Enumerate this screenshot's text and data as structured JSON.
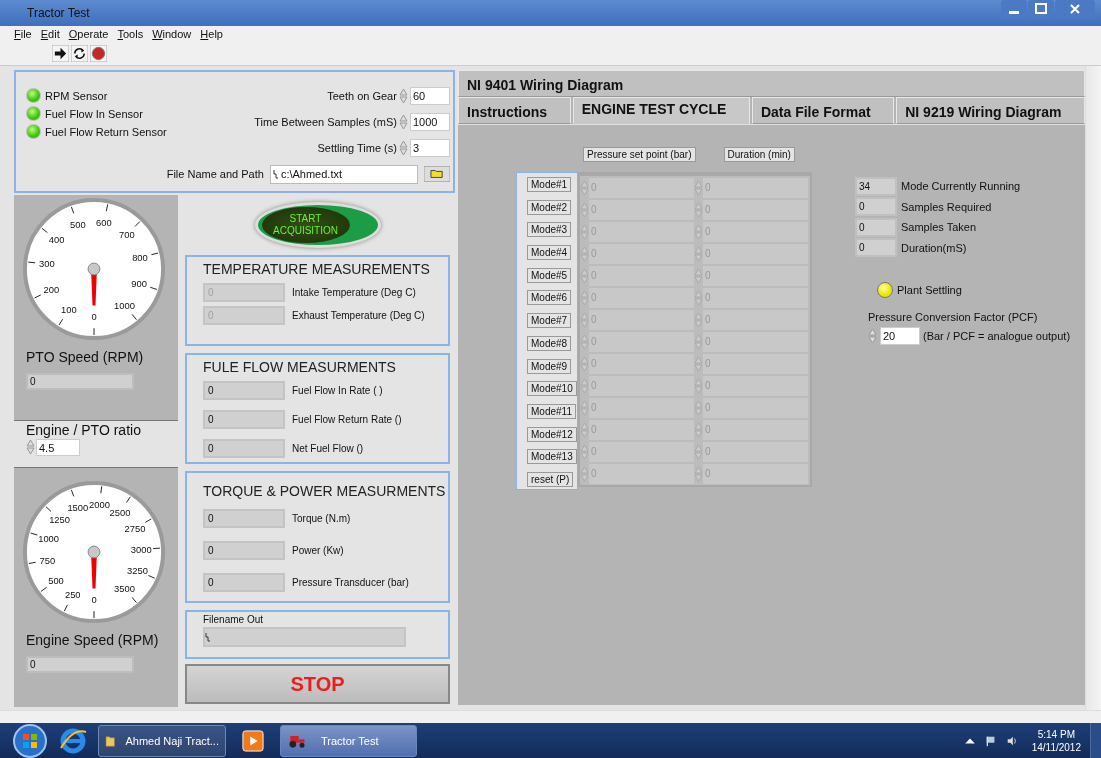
{
  "window": {
    "title": "Tractor Test"
  },
  "menu": [
    "File",
    "Edit",
    "Operate",
    "Tools",
    "Window",
    "Help"
  ],
  "sensors": [
    {
      "label": "RPM Sensor",
      "on": true
    },
    {
      "label": "Fuel Flow In Sensor",
      "on": true
    },
    {
      "label": "Fuel Flow Return Sensor",
      "on": true
    }
  ],
  "settings": [
    {
      "label": "Teeth on Gear",
      "value": "60"
    },
    {
      "label": "Time Between Samples (mS)",
      "value": "1000"
    },
    {
      "label": "Settling Time (s)",
      "value": "3"
    }
  ],
  "file_path": {
    "label": "File Name and Path",
    "value": "c:\\Ahmed.txt"
  },
  "pto_gauge": {
    "scale": [
      "0",
      "100",
      "200",
      "300",
      "400",
      "500",
      "600",
      "700",
      "800",
      "900",
      "1000"
    ],
    "title": "PTO Speed (RPM)",
    "value": "0"
  },
  "ratio": {
    "label": "Engine / PTO ratio",
    "value": "4.5"
  },
  "engine_gauge": {
    "scale": [
      "0",
      "250",
      "500",
      "750",
      "1000",
      "1250",
      "1500",
      "2000",
      "2500",
      "2750",
      "3000",
      "3250",
      "3500"
    ],
    "title": "Engine Speed (RPM)",
    "value": "0"
  },
  "start_button": {
    "label": "START ACQUISITION"
  },
  "groups": [
    {
      "title": "TEMPERATURE MEASUREMENTS",
      "fields": [
        {
          "label": "Intake Temperature (Deg C)",
          "value": "0",
          "disabled": true
        },
        {
          "label": "Exhaust Temperature (Deg C)",
          "value": "0",
          "disabled": true
        }
      ]
    },
    {
      "title": "FULE FLOW MEASURMENTS",
      "fields": [
        {
          "label": "Fuel Flow In Rate ( )",
          "value": "0",
          "disabled": false
        },
        {
          "label": "Fuel Flow Return Rate ()",
          "value": "0",
          "disabled": false
        },
        {
          "label": "Net Fuel Flow ()",
          "value": "0",
          "disabled": false
        }
      ]
    },
    {
      "title": "TORQUE & POWER MEASURMENTS",
      "fields": [
        {
          "label": "Torque (N.m)",
          "value": "0",
          "disabled": false
        },
        {
          "label": "Power (Kw)",
          "value": "0",
          "disabled": false
        },
        {
          "label": "Pressure Transducer (bar)",
          "value": "0",
          "disabled": false
        }
      ]
    }
  ],
  "filename_out": {
    "label": "Filename Out"
  },
  "stop_button": {
    "label": "STOP"
  },
  "tab_rows": [
    [
      {
        "label": "NI 9401 Wiring Diagram",
        "selected": false
      }
    ],
    [
      {
        "label": "Instructions",
        "selected": false
      },
      {
        "label": "ENGINE TEST CYCLE",
        "selected": true
      },
      {
        "label": "Data File Format",
        "selected": false
      },
      {
        "label": "NI 9219 Wiring Diagram",
        "selected": false
      }
    ]
  ],
  "cycle": {
    "headers": [
      "Pressure set point (bar)",
      "Duration (min)"
    ],
    "modes": [
      {
        "label": "Mode#1",
        "pressure": "0",
        "duration": "0",
        "disabled": true
      },
      {
        "label": "Mode#2",
        "pressure": "0",
        "duration": "0",
        "disabled": true
      },
      {
        "label": "Mode#3",
        "pressure": "0",
        "duration": "0",
        "disabled": true
      },
      {
        "label": "Mode#4",
        "pressure": "0",
        "duration": "0",
        "disabled": true
      },
      {
        "label": "Mode#5",
        "pressure": "0",
        "duration": "0",
        "disabled": true
      },
      {
        "label": "Mode#6",
        "pressure": "0",
        "duration": "0",
        "disabled": true
      },
      {
        "label": "Mode#7",
        "pressure": "0",
        "duration": "0",
        "disabled": true
      },
      {
        "label": "Mode#8",
        "pressure": "0",
        "duration": "0",
        "disabled": true
      },
      {
        "label": "Mode#9",
        "pressure": "0",
        "duration": "0",
        "disabled": true
      },
      {
        "label": "Mode#10",
        "pressure": "0",
        "duration": "0",
        "disabled": true
      },
      {
        "label": "Mode#11",
        "pressure": "0",
        "duration": "0",
        "disabled": true
      },
      {
        "label": "Mode#12",
        "pressure": "0",
        "duration": "0",
        "disabled": true
      },
      {
        "label": "Mode#13",
        "pressure": "0",
        "duration": "0",
        "disabled": true
      },
      {
        "label": "reset (P)",
        "pressure": "0",
        "duration": "0",
        "disabled": true
      }
    ]
  },
  "status": [
    {
      "label": "Mode Currently Running",
      "value": "34"
    },
    {
      "label": "Samples Required",
      "value": "0"
    },
    {
      "label": "Samples Taken",
      "value": "0"
    },
    {
      "label": "Duration(mS)",
      "value": "0"
    }
  ],
  "plant_settling": {
    "label": "Plant Settling",
    "on": true
  },
  "pcf": {
    "label": "Pressure Conversion Factor (PCF)",
    "value": "20",
    "note": "(Bar / PCF = analogue output)"
  },
  "taskbar": {
    "items": [
      {
        "kind": "browser",
        "selected": false
      },
      {
        "kind": "folder",
        "label": "Ahmed Naji Tract...",
        "selected": false
      },
      {
        "kind": "media",
        "selected": false
      },
      {
        "kind": "app",
        "label": "Tractor Test",
        "selected": true
      }
    ],
    "time": "5:14 PM",
    "date": "14/11/2012"
  }
}
